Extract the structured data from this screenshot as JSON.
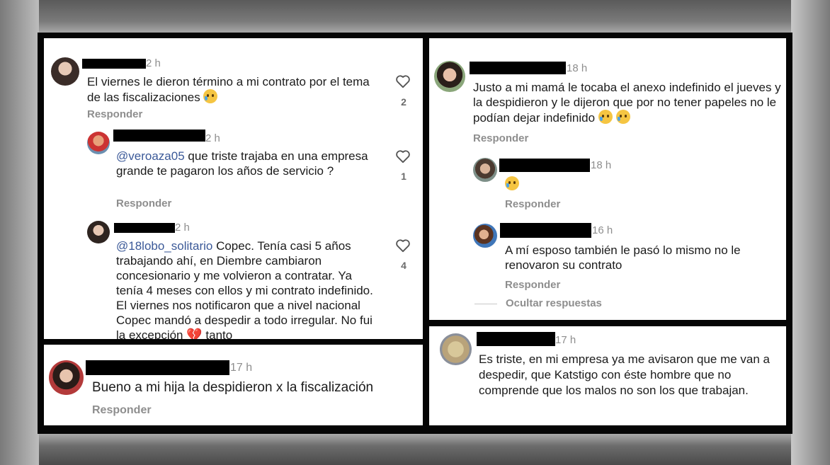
{
  "panel_top_left": {
    "comments": [
      {
        "time": "2 h",
        "text": "El viernes le dieron término a mi contrato por el tema de las fiscalizaciones",
        "reply": "Responder",
        "likes": "2"
      },
      {
        "time": "2 h",
        "mention": "@veroaza05",
        "text": " que triste trajaba en una empresa grande te pagaron los años de servicio ?",
        "reply": "Responder",
        "likes": "1"
      },
      {
        "time": "2 h",
        "mention": "@18lobo_solitario",
        "text": " Copec. Tenía casi 5 años trabajando ahí, en Diembre cambiaron concesionario y me volvieron a contratar. Ya tenía 4 meses con ellos y mi contrato indefinido. El viernes nos notificaron que a nivel nacional Copec mandó a despedir a todo irregular. No fui la excepción",
        "text_tail": " tanto",
        "likes": "4"
      }
    ]
  },
  "panel_top_right": {
    "comments": [
      {
        "time": "18 h",
        "text": "Justo a mi mamá le tocaba el anexo indefinido el jueves y la despidieron y le dijeron que por no tener papeles no le podían dejar indefinido",
        "reply": "Responder"
      },
      {
        "time": "18 h",
        "text": "",
        "reply": "Responder"
      },
      {
        "time": "16 h",
        "text": "A mí esposo también le pasó lo mismo no le renovaron su contrato",
        "reply": "Responder"
      }
    ],
    "hide_replies": "Ocultar respuestas"
  },
  "panel_bottom_left": {
    "time": "17 h",
    "text": "Bueno a mi hija la despidieron x la fiscalización",
    "reply": "Responder"
  },
  "panel_bottom_right": {
    "time": "17 h",
    "text": "Es triste, en mi empresa ya me avisaron que me van a despedir, que Katstigo con éste hombre que no comprende que los malos no son los que trabajan."
  },
  "icons": {
    "heart": "heart-outline-icon",
    "cry": "crying-face-emoji",
    "broken_heart": "broken-heart-emoji"
  }
}
